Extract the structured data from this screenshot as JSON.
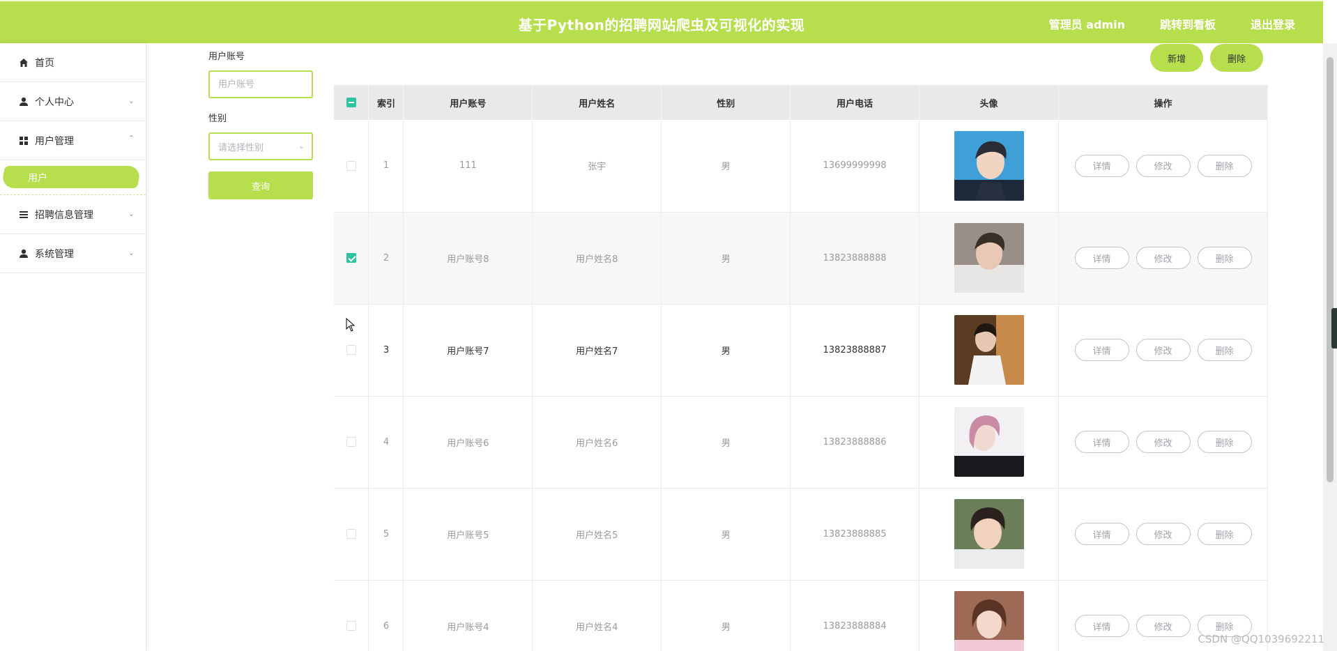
{
  "header": {
    "title": "基于Python的招聘网站爬虫及可视化的实现",
    "admin": "管理员 admin",
    "dashboard": "跳转到看板",
    "logout": "退出登录"
  },
  "sidebar": {
    "items": [
      {
        "label": "首页",
        "icon": "home-icon"
      },
      {
        "label": "个人中心",
        "icon": "user-icon"
      },
      {
        "label": "用户管理",
        "icon": "grid-icon"
      },
      {
        "label": "招聘信息管理",
        "icon": "list-icon"
      },
      {
        "label": "系统管理",
        "icon": "user-icon"
      }
    ],
    "active_sub": "用户"
  },
  "search": {
    "account_label": "用户账号",
    "account_placeholder": "用户账号",
    "gender_label": "性别",
    "gender_placeholder": "请选择性别",
    "query_button": "查询"
  },
  "toolbar": {
    "add": "新增",
    "delete": "删除"
  },
  "table": {
    "columns": [
      "索引",
      "用户账号",
      "用户姓名",
      "性别",
      "用户电话",
      "头像",
      "操作"
    ],
    "rows": [
      {
        "index": "1",
        "account": "111",
        "name": "张宇",
        "gender": "男",
        "phone": "13699999998",
        "checked": false
      },
      {
        "index": "2",
        "account": "用户账号8",
        "name": "用户姓名8",
        "gender": "男",
        "phone": "13823888888",
        "checked": true
      },
      {
        "index": "3",
        "account": "用户账号7",
        "name": "用户姓名7",
        "gender": "男",
        "phone": "13823888887",
        "checked": false
      },
      {
        "index": "4",
        "account": "用户账号6",
        "name": "用户姓名6",
        "gender": "男",
        "phone": "13823888886",
        "checked": false
      },
      {
        "index": "5",
        "account": "用户账号5",
        "name": "用户姓名5",
        "gender": "男",
        "phone": "13823888885",
        "checked": false
      },
      {
        "index": "6",
        "account": "用户账号4",
        "name": "用户姓名4",
        "gender": "男",
        "phone": "13823888884",
        "checked": false
      }
    ],
    "actions": {
      "detail": "详情",
      "edit": "修改",
      "remove": "删除"
    }
  },
  "watermark": "CSDN @QQ1039692211",
  "colors": {
    "accent": "#b6de4d",
    "check": "#2bc3a0"
  }
}
